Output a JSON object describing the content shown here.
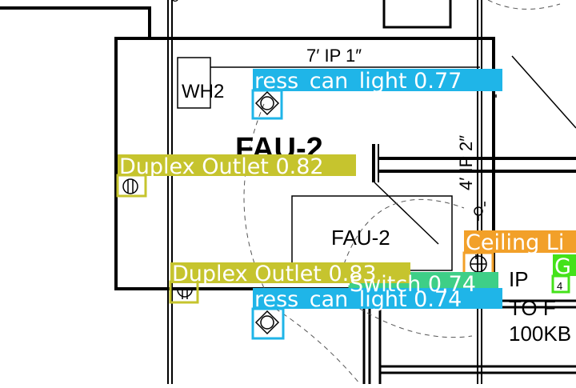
{
  "drawing": {
    "top_partial_text": "ο",
    "dimension_horizontal": "7′ IP 1″",
    "dimension_vertical": "4′ IP 2″",
    "room_label_large": "FAU-2",
    "unit_box_label": "FAU-2",
    "wh_label": "WH2",
    "right_text_1": "IP",
    "right_text_2": "TO F",
    "right_text_3": "100KB",
    "small_mark": "4"
  },
  "colors": {
    "recessed_can_light": "#1fb5e8",
    "duplex_outlet": "#c6c42e",
    "switch": "#3ecf87",
    "ceiling_light": "#f2a029",
    "green_detection": "#44e21a"
  },
  "detections": [
    {
      "name": "recessed-can-light-detection-1",
      "label": "ress_can_light 0.77"
    },
    {
      "name": "duplex-outlet-detection-1",
      "label": "Duplex Outlet 0.82"
    },
    {
      "name": "ceiling-light-detection",
      "label": "Ceiling Li"
    },
    {
      "name": "green-detection",
      "label": "G"
    },
    {
      "name": "switch-detection",
      "label": "Switch 0.74"
    },
    {
      "name": "recessed-can-light-detection-2",
      "label": "ress_can_light 0.74"
    },
    {
      "name": "duplex-outlet-detection-2",
      "label": "Duplex Outlet 0.83"
    }
  ]
}
